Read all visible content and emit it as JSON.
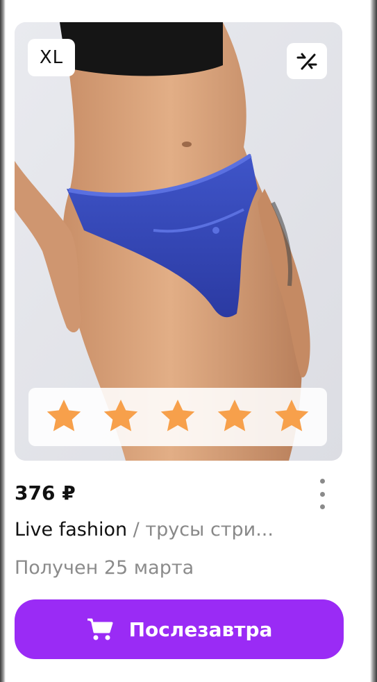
{
  "product": {
    "size_badge": "XL",
    "rating": {
      "value": 5,
      "max": 5,
      "star_color": "#f7a04b"
    },
    "price": "376 ₽",
    "brand": "Live fashion",
    "separator": " / ",
    "name": "трусы стри...",
    "status": "Получен 25 марта"
  },
  "actions": {
    "compare_icon": "compare-arrows-icon",
    "more_icon": "more-vertical-icon",
    "buy_button_label": "Послезавтра",
    "buy_button_icon": "cart-icon",
    "buy_button_color": "#9a2bf5"
  }
}
